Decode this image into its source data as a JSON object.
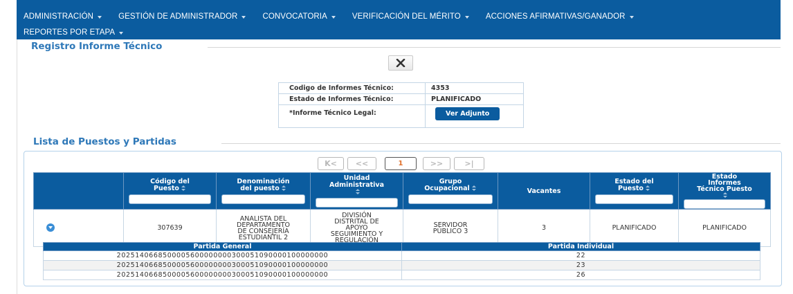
{
  "nav": {
    "items_row1": [
      {
        "label": "ADMINISTRACIÓN",
        "has_caret": true
      },
      {
        "label": "GESTIÓN DE ADMINISTRADOR",
        "has_caret": true
      },
      {
        "label": "CONVOCATORIA",
        "has_caret": true
      },
      {
        "label": "VERIFICACIÓN DEL MÉRITO",
        "has_caret": true
      },
      {
        "label": "ACCIONES AFIRMATIVAS/GANADOR",
        "has_caret": true
      }
    ],
    "items_row2": [
      {
        "label": "REPORTES POR ETAPA",
        "has_caret": true
      }
    ]
  },
  "registro": {
    "title": "Registro Informe Técnico",
    "close_icon": "close-x-icon",
    "info": {
      "codigo_label": "Codigo de Informes Técnico:",
      "codigo_value": "4353",
      "estado_label": "Estado de Informes Técnico:",
      "estado_value": "PLANIFICADO",
      "legal_label": "*Informe Técnico Legal:",
      "ver_adjunto_label": "Ver Adjunto"
    }
  },
  "lista": {
    "title": "Lista de Puestos y Partidas",
    "pager": {
      "first": "K<",
      "prev": "<<",
      "current": "1",
      "next": ">>",
      "last": ">|"
    },
    "columns": [
      {
        "key": "expand",
        "lines": []
      },
      {
        "key": "codigo",
        "lines": [
          "Código del",
          "Puesto"
        ],
        "sortable": true,
        "filter": true
      },
      {
        "key": "denominacion",
        "lines": [
          "Denominación",
          "del puesto"
        ],
        "sortable": true,
        "filter": true
      },
      {
        "key": "unidad",
        "lines": [
          "Unidad",
          "Administrativa"
        ],
        "sortable": true,
        "filter": true
      },
      {
        "key": "grupo",
        "lines": [
          "Grupo",
          "Ocupacional"
        ],
        "sortable": true,
        "filter": true
      },
      {
        "key": "vacantes",
        "lines": [
          "Vacantes"
        ],
        "sortable": false,
        "filter": false
      },
      {
        "key": "estado_puesto",
        "lines": [
          "Estado del",
          "Puesto"
        ],
        "sortable": true,
        "filter": true
      },
      {
        "key": "estado_informe",
        "lines": [
          "Estado",
          "Informes",
          "Técnico Puesto"
        ],
        "sortable": true,
        "filter": true
      }
    ],
    "rows": [
      {
        "codigo": "307639",
        "denominacion": [
          "ANALISTA DEL",
          "DEPARTAMENTO",
          "DE CONSEJERÍA",
          "ESTUDIANTIL 2"
        ],
        "unidad": [
          "DIVISIÓN",
          "DISTRITAL DE",
          "APOYO",
          "SEGUIMIENTO Y",
          "REGULACIÓN"
        ],
        "grupo": [
          "SERVIDOR",
          "PÚBLICO 3"
        ],
        "vacantes": "3",
        "estado_puesto": "PLANIFICADO",
        "estado_informe": "PLANIFICADO"
      }
    ],
    "partidas": {
      "headers": [
        "Partida General",
        "Partida Individual"
      ],
      "rows": [
        {
          "general": "2025140668500005600000000300051090000100000000",
          "individual": "22"
        },
        {
          "general": "2025140668500005600000000300051090000100000000",
          "individual": "23"
        },
        {
          "general": "2025140668500005600000000300051090000100000000",
          "individual": "26"
        }
      ]
    }
  },
  "colors": {
    "primary": "#0b5c9f",
    "section_title": "#2e78b8",
    "pager_current": "#e0702b"
  }
}
